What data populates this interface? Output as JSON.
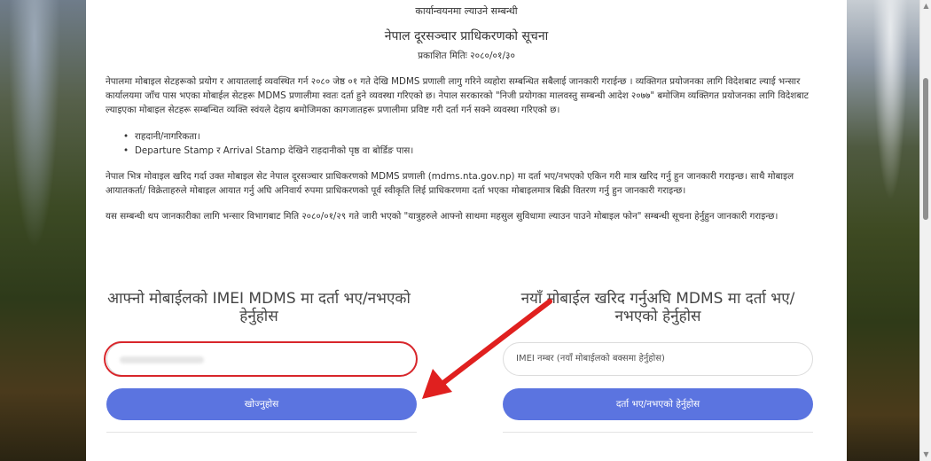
{
  "notice": {
    "section_label": "कार्यान्वयनमा ल्याउने सम्बन्धी",
    "title": "नेपाल दूरसञ्चार प्राधिकरणको सूचना",
    "published": "प्रकाशित मितिः २०८०/०१/३०",
    "para1": "नेपालमा मोबाइल सेटहरूको प्रयोग र आयातलाई व्यवस्थित गर्न २०८० जेष्ठ ०१ गते देखि MDMS प्रणाली लागु गरिने व्यहोरा सम्बन्धित सबैलाई जानकारी गराईन्छ । व्यक्तिगत प्रयोजनका लागि विदेशबाट ल्याई भन्सार कार्यालयमा जाँच पास भएका मोबाईल सेटहरू MDMS प्रणालीमा स्वतः दर्ता हुने व्यवस्था गरिएको छ। नेपाल सरकारको \"निजी प्रयोगका मालवस्तु सम्बन्धी आदेश २०७७\" बमोजिम व्यक्तिगत प्रयोजनका लागि विदेशबाट ल्याइएका मोबाइल सेटहरू सम्बन्धित व्यक्ति स्वंयले देहाय बमोजिमका कागजातहरू प्रणालीमा प्रविष्ट गरी दर्ता गर्न सक्ने व्यवस्था गरिएको छ।",
    "bullets": [
      "राहदानी/नागरिकता।",
      "Departure Stamp र Arrival Stamp देखिने राहदानीको पृष्ठ वा बोर्डिङ पास।"
    ],
    "para2": "नेपाल भित्र मोवाइल खरिद गर्दा उक्त मोबाइल सेट नेपाल दूरसञ्चार प्राधिकरणको MDMS प्रणाली (mdms.nta.gov.np) मा दर्ता भए/नभएको एकिन गरी मात्र खरिद गर्नु हुन जानकारी गराइन्छ। साथै मोबाइल आयातकर्ता/ विक्रेताहरुले मोबाइल आयात गर्नु अघि अनिवार्य रुपमा प्राधिकरणको पूर्व स्वीकृति लिई प्राधिकरणमा दर्ता भएका मोबाइलमात्र बिक्री वितरण गर्नु हुन जानकारी गराइन्छ।",
    "para3": "यस सम्बन्धी थप जानकारीका लागि भन्सार विभागबाट मिति २०८०/०१/२९ गते जारी भएको \"यात्रुहरुले आफ्नो साथमा महसुल सुविधामा ल्याउन पाउने मोबाइल फोन\" सम्बन्धी सूचना हेर्नुहुन जानकारी गराइन्छ।"
  },
  "check_form": {
    "heading": "आफ्नो मोबाईलको IMEI MDMS मा दर्ता भए/नभएको हेर्नुहोस",
    "input_value": "",
    "button_label": "खोज्नुहोस"
  },
  "new_form": {
    "heading": "नयाँ मोबाईल खरिद गर्नुअघि MDMS मा दर्ता भए/नभएको हेर्नुहोस",
    "input_placeholder": "IMEI नम्बर (नयाँ मोबाईलको बक्समा हेर्नुहोस)",
    "button_label": "दर्ता भए/नभएको हेर्नुहोस"
  },
  "colors": {
    "button": "#5b74e0",
    "highlight": "#d8262b",
    "arrow": "#e0201f"
  },
  "annotation_icon": "red-arrow-icon",
  "scroll_up_icon": "▲",
  "scroll_down_icon": "▼"
}
